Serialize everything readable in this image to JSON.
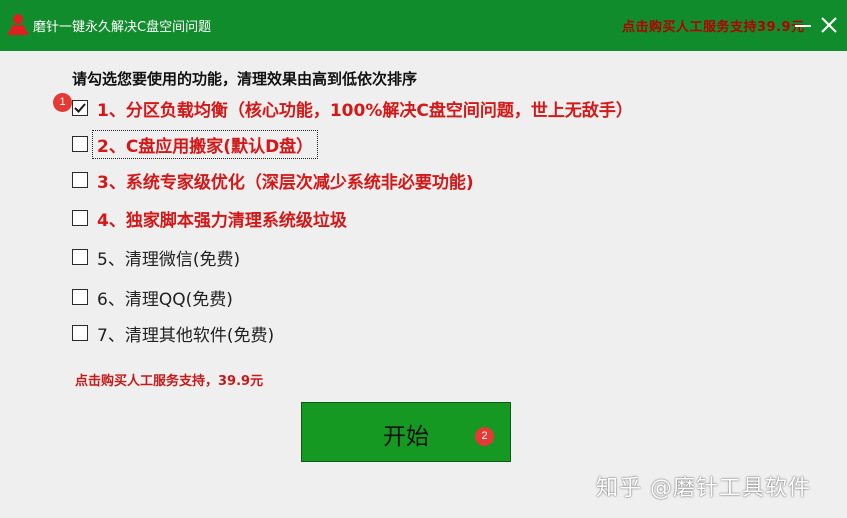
{
  "window": {
    "title": "磨针一键永久解决C盘空间问题",
    "promo_top": "点击购买人工服务支持39.9元",
    "minimize_label": "—",
    "close_label": "✕"
  },
  "prompt": "请勾选您要使用的功能，清理效果由高到低依次排序",
  "options": [
    {
      "label": "1、分区负载均衡（核心功能，100%解决C盘空间问题，世上无敌手）",
      "checked": true
    },
    {
      "label": "2、C盘应用搬家(默认D盘）",
      "checked": false
    },
    {
      "label": "3、系统专家级优化（深层次减少系统非必要功能)",
      "checked": false
    },
    {
      "label": "4、独家脚本强力清理系统级垃圾",
      "checked": false
    },
    {
      "label": "5、清理微信(免费)",
      "checked": false
    },
    {
      "label": "6、清理QQ(免费)",
      "checked": false
    },
    {
      "label": "7、清理其他软件(免费)",
      "checked": false
    }
  ],
  "promo_bottom": "点击购买人工服务支持，39.9元",
  "start_button": "开始",
  "badges": [
    "1",
    "2"
  ],
  "watermark": "知乎 @磨针工具软件",
  "colors": {
    "titlebar": "#118c2d",
    "start_button": "#169922",
    "red_text": "#d41818",
    "badge": "#e53935"
  },
  "icons": {
    "app": "person-stamp-icon",
    "minimize": "minimize-icon",
    "close": "close-icon",
    "check": "checkmark-icon"
  }
}
